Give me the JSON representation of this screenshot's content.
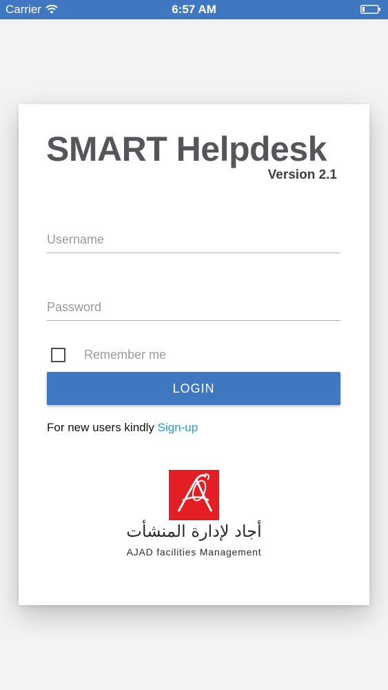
{
  "status_bar": {
    "carrier": "Carrier",
    "wifi_icon": "wifi-icon",
    "time": "6:57 AM",
    "battery_icon": "battery-icon",
    "background_color": "#3f77c0"
  },
  "login_card": {
    "app_title": "SMART Helpdesk",
    "version": "Version 2.1",
    "username": {
      "placeholder": "Username",
      "value": ""
    },
    "password": {
      "placeholder": "Password",
      "value": ""
    },
    "remember_me": {
      "label": "Remember me",
      "checked": false
    },
    "login_button": "LOGIN",
    "signup_prompt": "For new users kindly",
    "signup_link": "Sign-up",
    "accent_color": "#3f77c0",
    "link_color": "#1e9bd7"
  },
  "branding": {
    "logo_icon": "ajad-logo-icon",
    "logo_color": "#e31e25",
    "arabic_name": "أجاد لإدارة المنشأت",
    "english_name": "AJAD facilities Management"
  }
}
